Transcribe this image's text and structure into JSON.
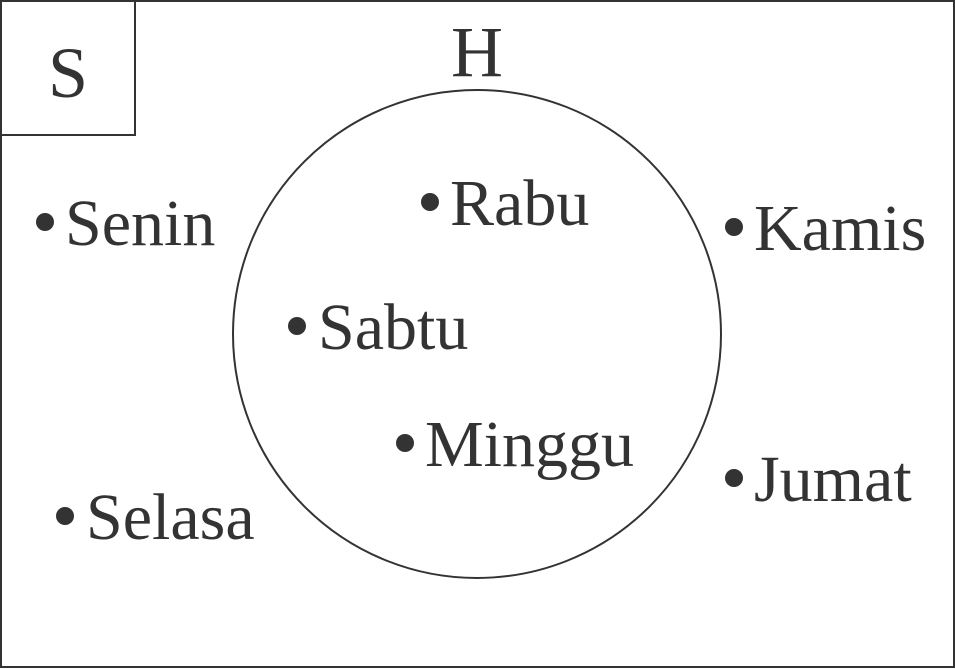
{
  "universal_set": {
    "label": "S"
  },
  "set_h": {
    "label": "H"
  },
  "inside": [
    "Rabu",
    "Sabtu",
    "Minggu"
  ],
  "outside": [
    "Senin",
    "Selasa",
    "Kamis",
    "Jumat"
  ],
  "colors": {
    "stroke": "#333333",
    "text": "#333333",
    "background": "#ffffff"
  }
}
